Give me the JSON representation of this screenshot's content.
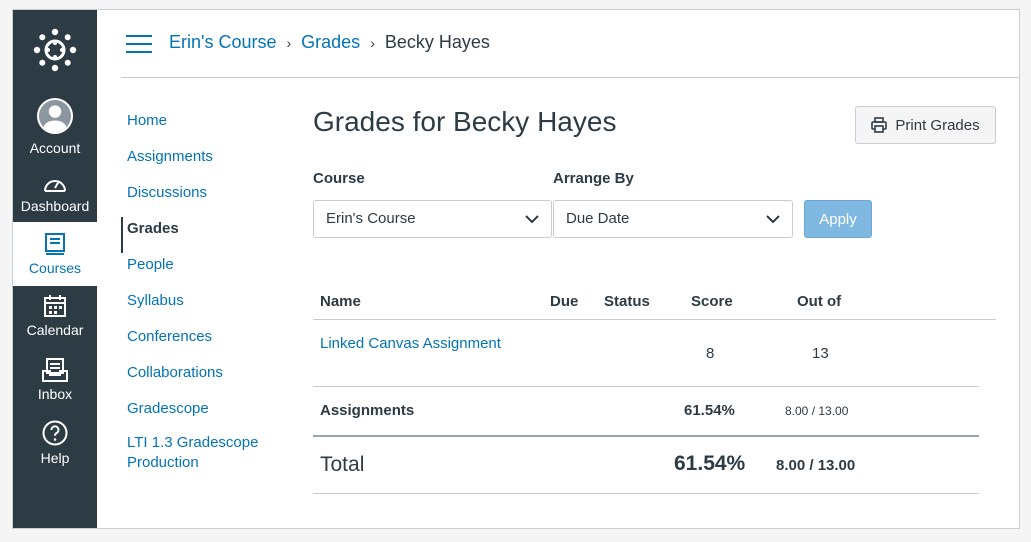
{
  "nav": {
    "items": [
      {
        "label": "Account"
      },
      {
        "label": "Dashboard"
      },
      {
        "label": "Courses"
      },
      {
        "label": "Calendar"
      },
      {
        "label": "Inbox"
      },
      {
        "label": "Help"
      }
    ]
  },
  "breadcrumb": {
    "course": "Erin's Course",
    "section": "Grades",
    "student": "Becky Hayes",
    "sep": "›"
  },
  "course_nav": [
    "Home",
    "Assignments",
    "Discussions",
    "Grades",
    "People",
    "Syllabus",
    "Conferences",
    "Collaborations",
    "Gradescope",
    "LTI 1.3 Gradescope Production"
  ],
  "page": {
    "title": "Grades for Becky Hayes",
    "print_label": "Print Grades",
    "course_label": "Course",
    "course_value": "Erin's Course",
    "arrange_label": "Arrange By",
    "arrange_value": "Due Date",
    "apply_label": "Apply"
  },
  "table": {
    "headers": {
      "name": "Name",
      "due": "Due",
      "status": "Status",
      "score": "Score",
      "out_of": "Out of"
    },
    "rows": [
      {
        "name": "Linked Canvas Assignment",
        "score": "8",
        "out_of": "13"
      }
    ],
    "group": {
      "name": "Assignments",
      "percent": "61.54%",
      "points": "8.00 / 13.00"
    },
    "total": {
      "name": "Total",
      "percent": "61.54%",
      "points": "8.00 / 13.00"
    }
  },
  "colors": {
    "brand": "#0374b5",
    "nav_bg": "#2d3b45",
    "apply_bg": "#7fb9e2"
  }
}
